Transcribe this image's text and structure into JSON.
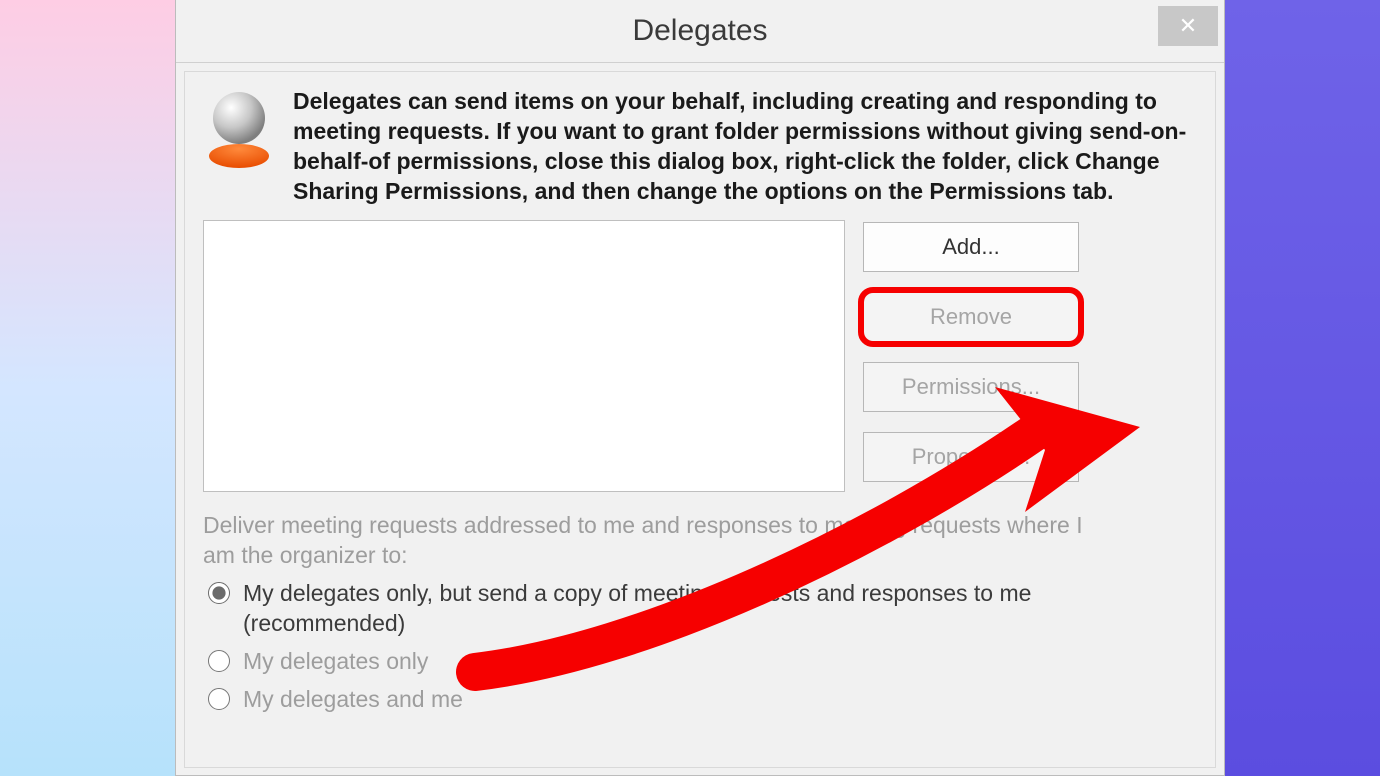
{
  "dialog": {
    "title": "Delegates",
    "close_glyph": "✕",
    "intro": "Delegates can send items on your behalf, including creating and responding to meeting requests. If you want to grant folder permissions without giving send-on-behalf-of permissions, close this dialog box, right-click the folder, click Change Sharing Permissions, and then change the options on the Permissions tab.",
    "buttons": {
      "add": "Add...",
      "remove": "Remove",
      "permissions": "Permissions...",
      "properties": "Properties..."
    },
    "deliver_label": "Deliver meeting requests addressed to me and responses to meeting requests where I am the organizer to:",
    "radio_options": [
      {
        "id": "opt1",
        "label": "My delegates only, but send a copy of meeting requests and responses to me (recommended)",
        "checked": true
      },
      {
        "id": "opt2",
        "label": "My delegates only",
        "checked": false
      },
      {
        "id": "opt3",
        "label": "My delegates and me",
        "checked": false
      }
    ]
  },
  "annotation": {
    "highlight_target": "remove-button"
  }
}
